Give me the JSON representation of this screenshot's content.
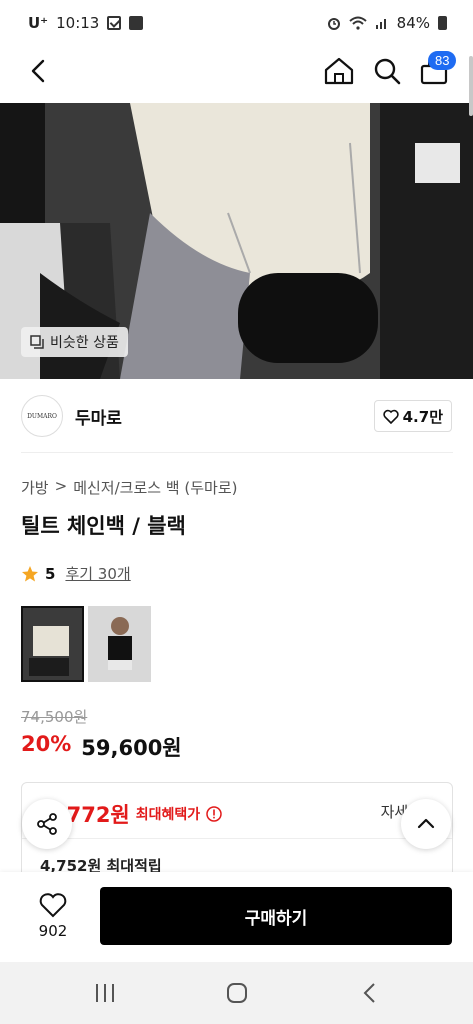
{
  "status": {
    "carrier": "U⁺",
    "time": "10:13",
    "battery": "84%"
  },
  "nav": {
    "cart_count": "83"
  },
  "hero": {
    "similar_label": "비슷한 상품"
  },
  "brand": {
    "logo_text": "DUMARO",
    "name": "두마로",
    "likes": "4.7만"
  },
  "breadcrumb": {
    "items": [
      "가방",
      "메신저/크로스 백 (두마로)"
    ],
    "sep": ">"
  },
  "product": {
    "title": "틸트 체인백 / 블랙",
    "rating": "5",
    "reviews": "후기 30개",
    "original_price": "74,500원",
    "discount": "20%",
    "price": "59,600원"
  },
  "benefit": {
    "max_price": "4,772원",
    "max_price_label": "최대혜택가",
    "detail": "자세히",
    "points": "4,752원 최대적립"
  },
  "bottom": {
    "like_count": "902",
    "buy_label": "구매하기"
  },
  "colors": {
    "accent": "#1e6bf2",
    "sale": "#e21a1a",
    "star": "#f5a623"
  }
}
